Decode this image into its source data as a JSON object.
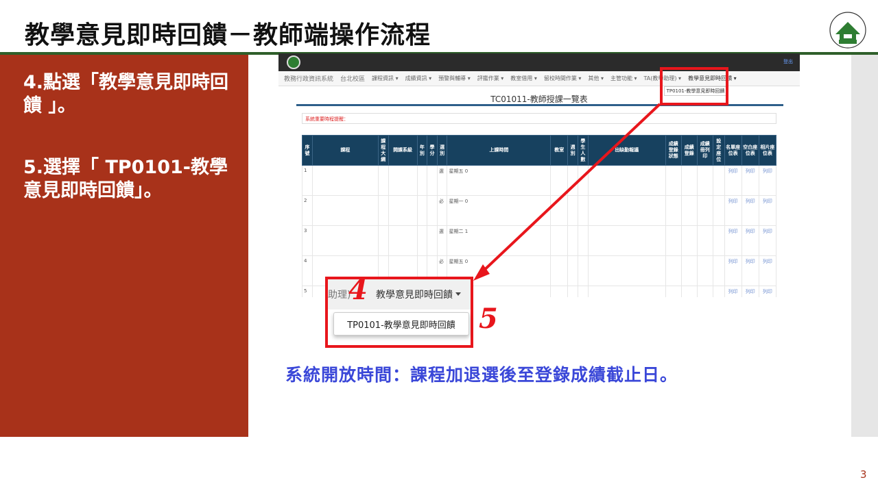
{
  "slide": {
    "title": "教學意見即時回饋－教師端操作流程",
    "page_number": "3",
    "step4": "4.點選「教學意見即時回饋 」。",
    "step5": "5.選擇「 TP0101-教學意見即時回饋」。",
    "open_time": "系統開放時間：課程加退選後至登錄成績截止日。",
    "callout_number_4": "4",
    "callout_number_5": "5"
  },
  "system": {
    "brand": "教務行政資訊系統",
    "campus": "台北校區",
    "user_link": "登出",
    "nav_items": [
      "課程資訊 ▾",
      "成績資訊 ▾",
      "預警與輔導 ▾",
      "評鑑作業 ▾",
      "教室借用 ▾",
      "留校時間作業 ▾",
      "其他 ▾",
      "主管功能 ▾",
      "TA(教學助理) ▾",
      "教學意見即時回饋 ▾"
    ],
    "dropdown_item": "TP0101-教學意見即時回饋",
    "page_title": "TC01011-教師授課一覽表",
    "notice": "系統重要時程提醒：",
    "table": {
      "headers": [
        "序號",
        "課程",
        "課程大綱",
        "開課系級",
        "年別",
        "學分",
        "選別",
        "上課時間",
        "教室",
        "週別",
        "學生人數",
        "出缺勤報議",
        "成績登錄狀態",
        "成績登錄",
        "成績冊列印",
        "設定座位",
        "名單座位表",
        "空白座位表",
        "相片座位表"
      ],
      "rows": [
        {
          "no": "1",
          "type": "選",
          "time": "星期五 0"
        },
        {
          "no": "2",
          "type": "必",
          "time": "星期一 0"
        },
        {
          "no": "3",
          "type": "選",
          "time": "星期二 1"
        },
        {
          "no": "4",
          "type": "必",
          "time": "星期五 0"
        },
        {
          "no": "5",
          "type": "",
          "time": ""
        }
      ],
      "print_label": "列印"
    }
  },
  "callout": {
    "prev_item": "助理)",
    "menu_item": "教學意見即時回饋",
    "option": "TP0101-教學意見即時回饋"
  },
  "colors": {
    "panel_red": "#a8321a",
    "highlight_red": "#e8161c",
    "text_blue": "#3a47d8",
    "header_navy": "#17415f",
    "title_rule_green": "#2f5f2a"
  }
}
